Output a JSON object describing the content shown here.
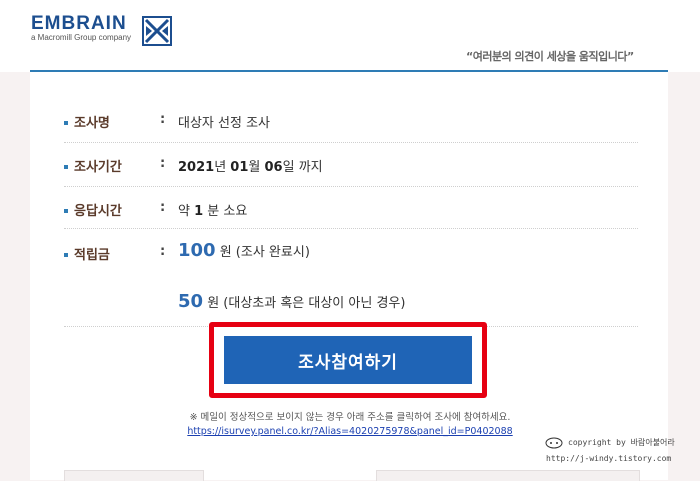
{
  "header": {
    "logo_text": "EMBRAIN",
    "logo_subtext": "a Macromill Group company",
    "slogan": "“여러분의 의견이 세상을 움직입니다”"
  },
  "survey": {
    "name_label": "조사명",
    "name_value": "대상자 선정 조사",
    "period_label": "조사기간",
    "period_year": "2021",
    "period_year_unit": "년",
    "period_month": "01",
    "period_month_unit": "월",
    "period_day": "06",
    "period_day_unit": "일",
    "period_suffix": "까지",
    "time_label": "응답시간",
    "time_prefix": "약",
    "time_value": "1",
    "time_suffix": "분 소요",
    "reward_label": "적립금",
    "reward_complete_amount": "100",
    "reward_complete_text": "원 (조사 완료시)",
    "reward_screen_amount": "50",
    "reward_screen_text": "원 (대상초과 혹은 대상이 아닌 경우)",
    "colon": ":"
  },
  "cta": {
    "label": "조사참여하기"
  },
  "notice": {
    "text": "※ 메일이 정상적으로 보이지 않는 경우 아래 주소를 클릭하여 조사에 참여하세요.",
    "link": "https://isurvey.panel.co.kr/?Alias=4020275978&panel_id=P0402088"
  },
  "watermark": {
    "line1": "copyright by 바람아불어라",
    "line2": "http://j-windy.tistory.com"
  },
  "colors": {
    "brand_blue": "#1f64b6",
    "highlight_red": "#e60012",
    "link_blue": "#1a3fb0"
  }
}
